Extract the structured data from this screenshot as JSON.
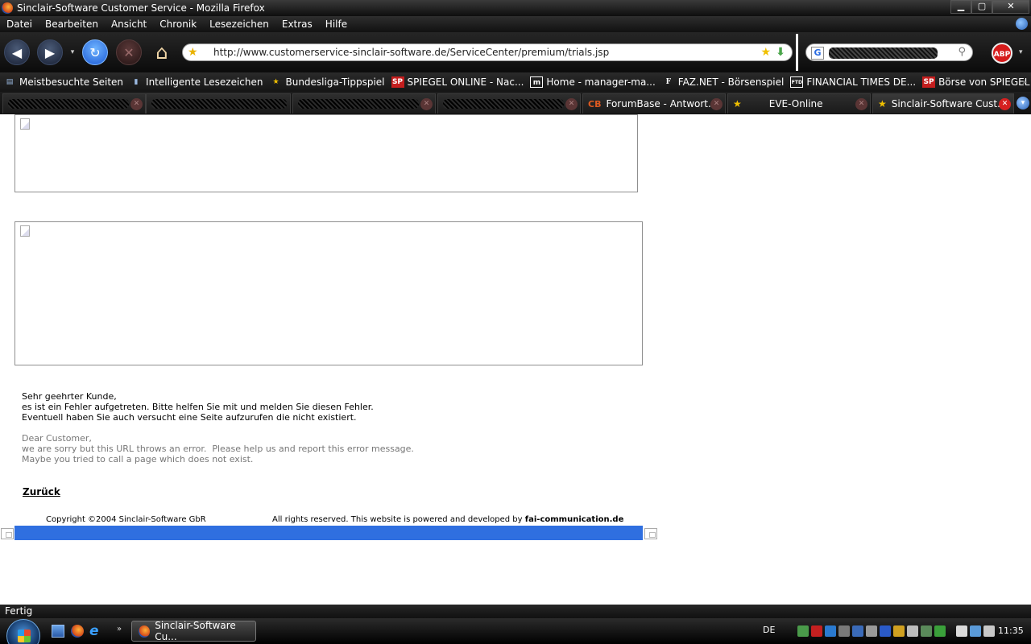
{
  "window": {
    "title": "Sinclair-Software Customer Service - Mozilla Firefox",
    "min_glyph": "▁",
    "max_glyph": "▢",
    "close_glyph": "✕"
  },
  "menu": [
    "Datei",
    "Bearbeiten",
    "Ansicht",
    "Chronik",
    "Lesezeichen",
    "Extras",
    "Hilfe"
  ],
  "nav": {
    "back_glyph": "◀",
    "forward_glyph": "▶",
    "dropdown_glyph": "▾",
    "reload_glyph": "↻",
    "stop_glyph": "✕",
    "home_glyph": "⌂",
    "url": "http://www.customerservice-sinclair-software.de/ServiceCenter/premium/trials.jsp",
    "search_engine_glyph": "G",
    "abp_label": "ABP"
  },
  "bookmarks": [
    {
      "label": "Meistbesuchte Seiten",
      "icon": "folder-icon",
      "glyph": "▤",
      "color": "#9ab8e0"
    },
    {
      "label": "Intelligente Lesezeichen",
      "icon": "smart-bookmark-icon",
      "glyph": "▮",
      "color": "#9ab8e0"
    },
    {
      "label": "Bundesliga-Tippspiel",
      "icon": "star-icon",
      "glyph": "★",
      "color": "#f0c000"
    },
    {
      "label": "SPIEGEL ONLINE - Nac...",
      "icon": "spiegel-icon",
      "glyph": "SP",
      "color": "#c41e1e"
    },
    {
      "label": "Home - manager-ma...",
      "icon": "manager-magazin-icon",
      "glyph": "m",
      "color": "#ffffff"
    },
    {
      "label": "FAZ.NET - Börsenspiel",
      "icon": "faz-icon",
      "glyph": "F",
      "color": "#ffffff"
    },
    {
      "label": "FINANCIAL TIMES DE...",
      "icon": "ftd-icon",
      "glyph": "FTD",
      "color": "#ffffff"
    },
    {
      "label": "Börse von SPIEGEL ON...",
      "icon": "spiegel-icon",
      "glyph": "SP",
      "color": "#c41e1e"
    }
  ],
  "bookmarks_more_glyph": "»",
  "tabs": [
    {
      "label": "",
      "redacted": true,
      "active": false
    },
    {
      "label": "",
      "redacted": true,
      "active": false
    },
    {
      "label": "",
      "redacted": true,
      "active": false
    },
    {
      "label": "",
      "redacted": true,
      "active": false
    },
    {
      "label": "ForumBase - Antwort...",
      "redacted": false,
      "active": false,
      "icon": "forumbase-icon",
      "glyph": "CB"
    },
    {
      "label": "EVE-Online",
      "redacted": false,
      "active": false,
      "icon": "star-icon",
      "glyph": "★"
    },
    {
      "label": "Sinclair-Software Cust...",
      "redacted": false,
      "active": true,
      "icon": "star-icon",
      "glyph": "★"
    }
  ],
  "tab_close_glyph": "✕",
  "tab_list_glyph": "▾",
  "content": {
    "msg_de": [
      "Sehr geehrter Kunde,",
      "es ist ein Fehler aufgetreten. Bitte helfen Sie mit und melden Sie diesen Fehler.",
      "Eventuell haben Sie auch versucht eine Seite aufzurufen die nicht existiert."
    ],
    "msg_en": [
      "Dear Customer,",
      "we are sorry but this URL throws an error.  Please help us and report this error message.",
      "Maybe you tried to call a page which does not exist."
    ],
    "back_label": "Zurück",
    "copyright": "Copyright ©2004 Sinclair-Software GbR",
    "rights": "All rights reserved. This website is powered and developed by",
    "developer": "fai-communication.de",
    "footer_color": "#2f6fe0"
  },
  "status": "Fertig",
  "taskbar": {
    "ql_more_glyph": "»",
    "task_label": "Sinclair-Software Cu...",
    "language": "DE",
    "clock": "11:35"
  }
}
